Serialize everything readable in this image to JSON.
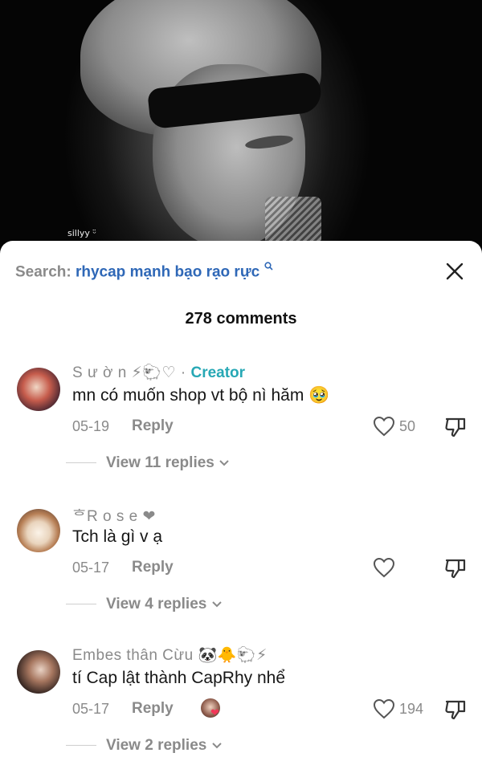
{
  "video": {
    "watermark": "sillyy ᵕ̈"
  },
  "search": {
    "label": "Search:",
    "query": "rhycap mạnh bạo rạo rực",
    "icon": "search-icon"
  },
  "header": {
    "comment_count": "278 comments"
  },
  "comments": [
    {
      "username": "S ư ờ n",
      "username_emoji": "⚡🐑♡ ·",
      "creator_badge": "Creator",
      "text": "mn có muốn shop vt bộ nì hăm 🥹",
      "date": "05-19",
      "reply_label": "Reply",
      "like_count": "50",
      "view_replies": "View 11 replies"
    },
    {
      "username": "ᄒR o s e ❤",
      "text": "Tch là gì v ạ",
      "date": "05-17",
      "reply_label": "Reply",
      "like_count": "",
      "view_replies": "View 4 replies"
    },
    {
      "username": "Embes thân Cừu",
      "username_emoji": "🐼🐥🐑⚡",
      "text": "tí Cap lật thành CapRhy nhể",
      "date": "05-17",
      "reply_label": "Reply",
      "like_count": "194",
      "view_replies": "View 2 replies"
    }
  ],
  "colors": {
    "accent_link": "#2f68b7",
    "creator": "#27a8b5",
    "muted": "#8a8a8a",
    "text": "#161616",
    "heart": "#f23657"
  }
}
